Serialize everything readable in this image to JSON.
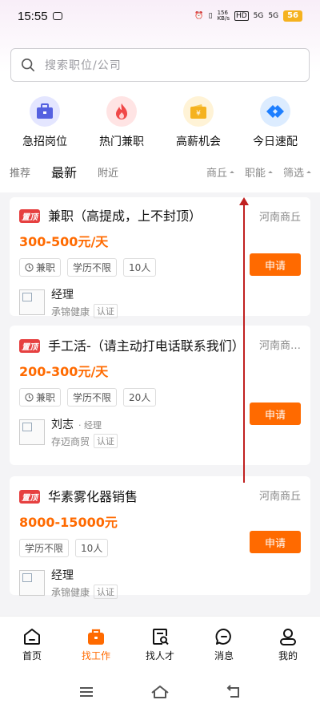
{
  "status": {
    "time": "15:55",
    "battery": "56",
    "net_speed": "156\nKB/s",
    "sim1": "5G",
    "sim2": "5G"
  },
  "search": {
    "placeholder": "搜索职位/公司"
  },
  "categories": [
    {
      "label": "急招岗位",
      "icon": "briefcase-icon",
      "bg": "#e4e6ff",
      "color": "#5561e0"
    },
    {
      "label": "热门兼职",
      "icon": "flame-icon",
      "bg": "#ffe4e4",
      "color": "#f04848"
    },
    {
      "label": "高薪机会",
      "icon": "yen-wallet-icon",
      "bg": "#fff3d6",
      "color": "#f5b21f"
    },
    {
      "label": "今日速配",
      "icon": "match-icon",
      "bg": "#dcecff",
      "color": "#1e7fff"
    }
  ],
  "tabs": [
    "推荐",
    "最新",
    "附近"
  ],
  "filters": [
    "商丘",
    "职能",
    "筛选"
  ],
  "jobs": [
    {
      "pin": "置顶",
      "title": "兼职（高提成，上不封顶）",
      "location": "河南商丘",
      "salary": "300-500元/天",
      "tags": [
        "兼职",
        "学历不限",
        "10人"
      ],
      "apply": "申请",
      "poster_name": "经理",
      "poster_role": "",
      "company": "承锦健康",
      "verified": "认证"
    },
    {
      "pin": "置顶",
      "title": "手工活-（请主动打电话联系我们）",
      "location": "河南商…",
      "salary": "200-300元/天",
      "tags": [
        "兼职",
        "学历不限",
        "20人"
      ],
      "apply": "申请",
      "poster_name": "刘志",
      "poster_role": "· 经理",
      "company": "存迈商贸",
      "verified": "认证"
    },
    {
      "pin": "置顶",
      "title": "华素雾化器销售",
      "location": "河南商丘",
      "salary": "8000-15000元",
      "tags": [
        "学历不限",
        "10人"
      ],
      "apply": "申请",
      "poster_name": "经理",
      "poster_role": "",
      "company": "承锦健康",
      "verified": "认证"
    }
  ],
  "nav": [
    {
      "label": "首页",
      "icon": "home-icon"
    },
    {
      "label": "找工作",
      "icon": "job-bag-icon",
      "active": true
    },
    {
      "label": "找人才",
      "icon": "talent-search-icon"
    },
    {
      "label": "消息",
      "icon": "message-icon"
    },
    {
      "label": "我的",
      "icon": "profile-icon"
    }
  ],
  "colors": {
    "accent": "#ff6a00",
    "pin": "#e64040"
  }
}
